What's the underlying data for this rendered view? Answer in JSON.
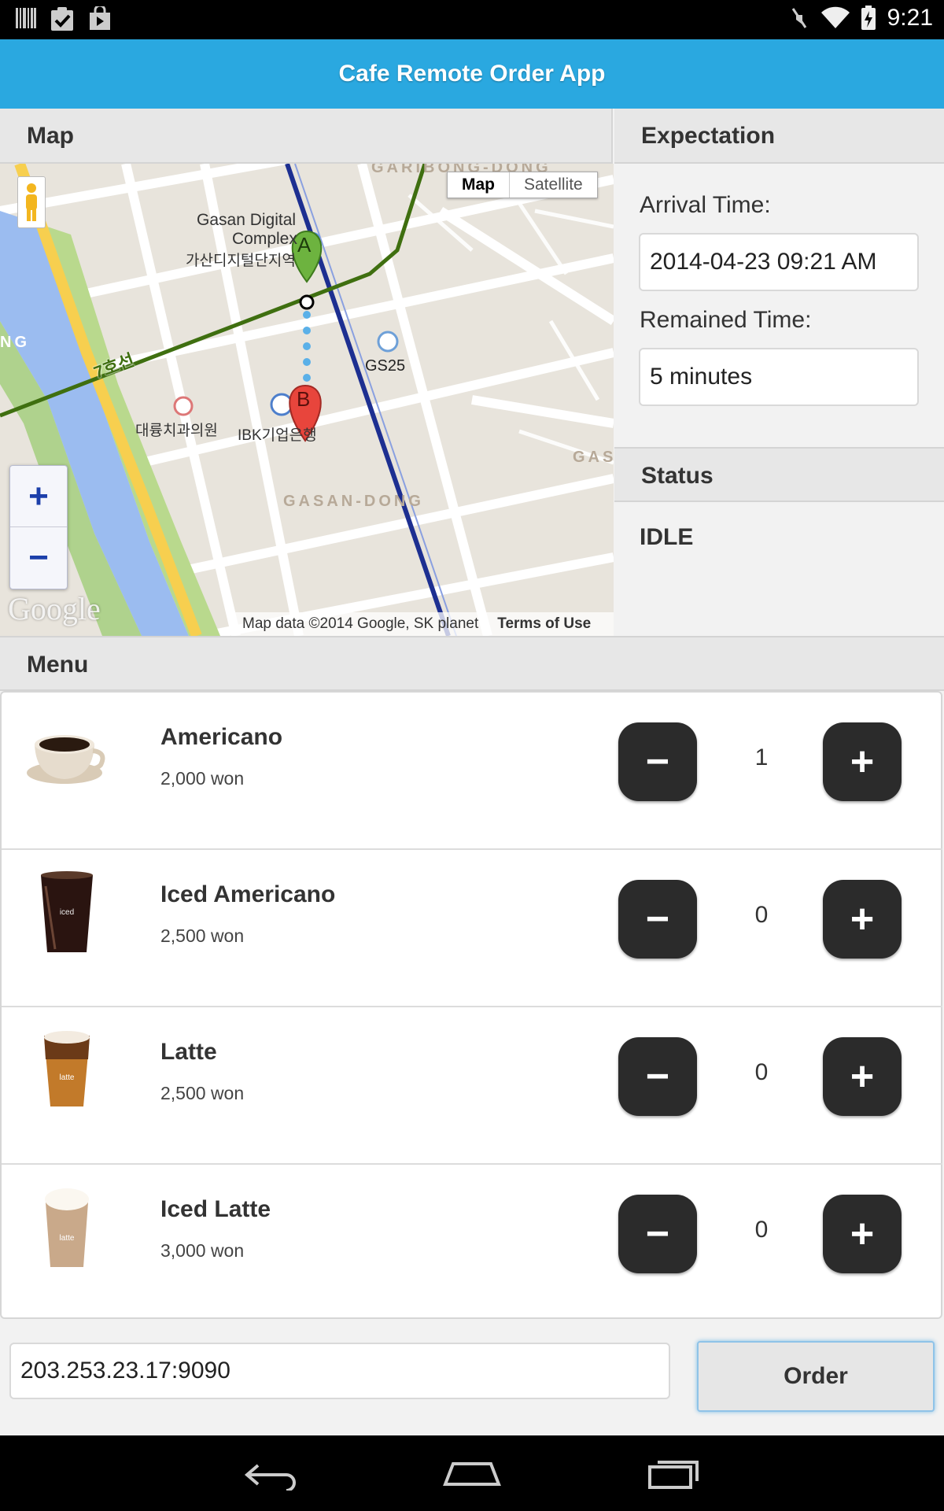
{
  "status_bar": {
    "time": "9:21",
    "left_icons": [
      "barcode-icon",
      "clipboard-check-icon",
      "play-store-icon"
    ],
    "right_icons": [
      "mute-icon",
      "wifi-icon",
      "battery-charging-icon"
    ]
  },
  "app": {
    "title": "Cafe Remote Order App"
  },
  "map": {
    "header": "Map",
    "type_map": "Map",
    "type_satellite": "Satellite",
    "zoom_in": "+",
    "zoom_out": "−",
    "footer_data": "Map data ©2014 Google, SK planet",
    "footer_terms": "Terms of Use",
    "logo": "Google",
    "labels": {
      "gasan_digital": "Gasan Digital",
      "complex": "Complex",
      "korean_complex": "가산디지털단지역",
      "gs25": "GS25",
      "line7": "7호선",
      "clinic": "대륭치과의원",
      "bank": "IBK기업은행",
      "gasan_dong": "GASAN-DONG",
      "garibong": "GARIBONG-DONG",
      "gas": "GAS",
      "ng": "NG",
      "marker_a": "A",
      "marker_b": "B"
    }
  },
  "expectation": {
    "header": "Expectation",
    "arrival_label": "Arrival Time:",
    "arrival_value": "2014-04-23 09:21 AM",
    "remained_label": "Remained Time:",
    "remained_value": "5 minutes"
  },
  "status": {
    "header": "Status",
    "value": "IDLE"
  },
  "menu": {
    "header": "Menu",
    "minus": "−",
    "plus": "+",
    "items": [
      {
        "name": "Americano",
        "price": "2,000 won",
        "qty": "1",
        "thumb": "hot-coffee-cup-icon"
      },
      {
        "name": "Iced Americano",
        "price": "2,500 won",
        "qty": "0",
        "thumb": "iced-coffee-icon"
      },
      {
        "name": "Latte",
        "price": "2,500 won",
        "qty": "0",
        "thumb": "latte-cup-icon"
      },
      {
        "name": "Iced Latte",
        "price": "3,000 won",
        "qty": "0",
        "thumb": "iced-latte-icon"
      }
    ]
  },
  "footer": {
    "server": "203.253.23.17:9090",
    "order_label": "Order"
  },
  "navbar": {
    "icons": [
      "back-icon",
      "home-icon",
      "recent-apps-icon"
    ]
  },
  "colors": {
    "action_bar": "#2aa8e0",
    "button_dark": "#2b2b2b",
    "route": "#1f3aa5",
    "line7": "#4a7a16"
  }
}
